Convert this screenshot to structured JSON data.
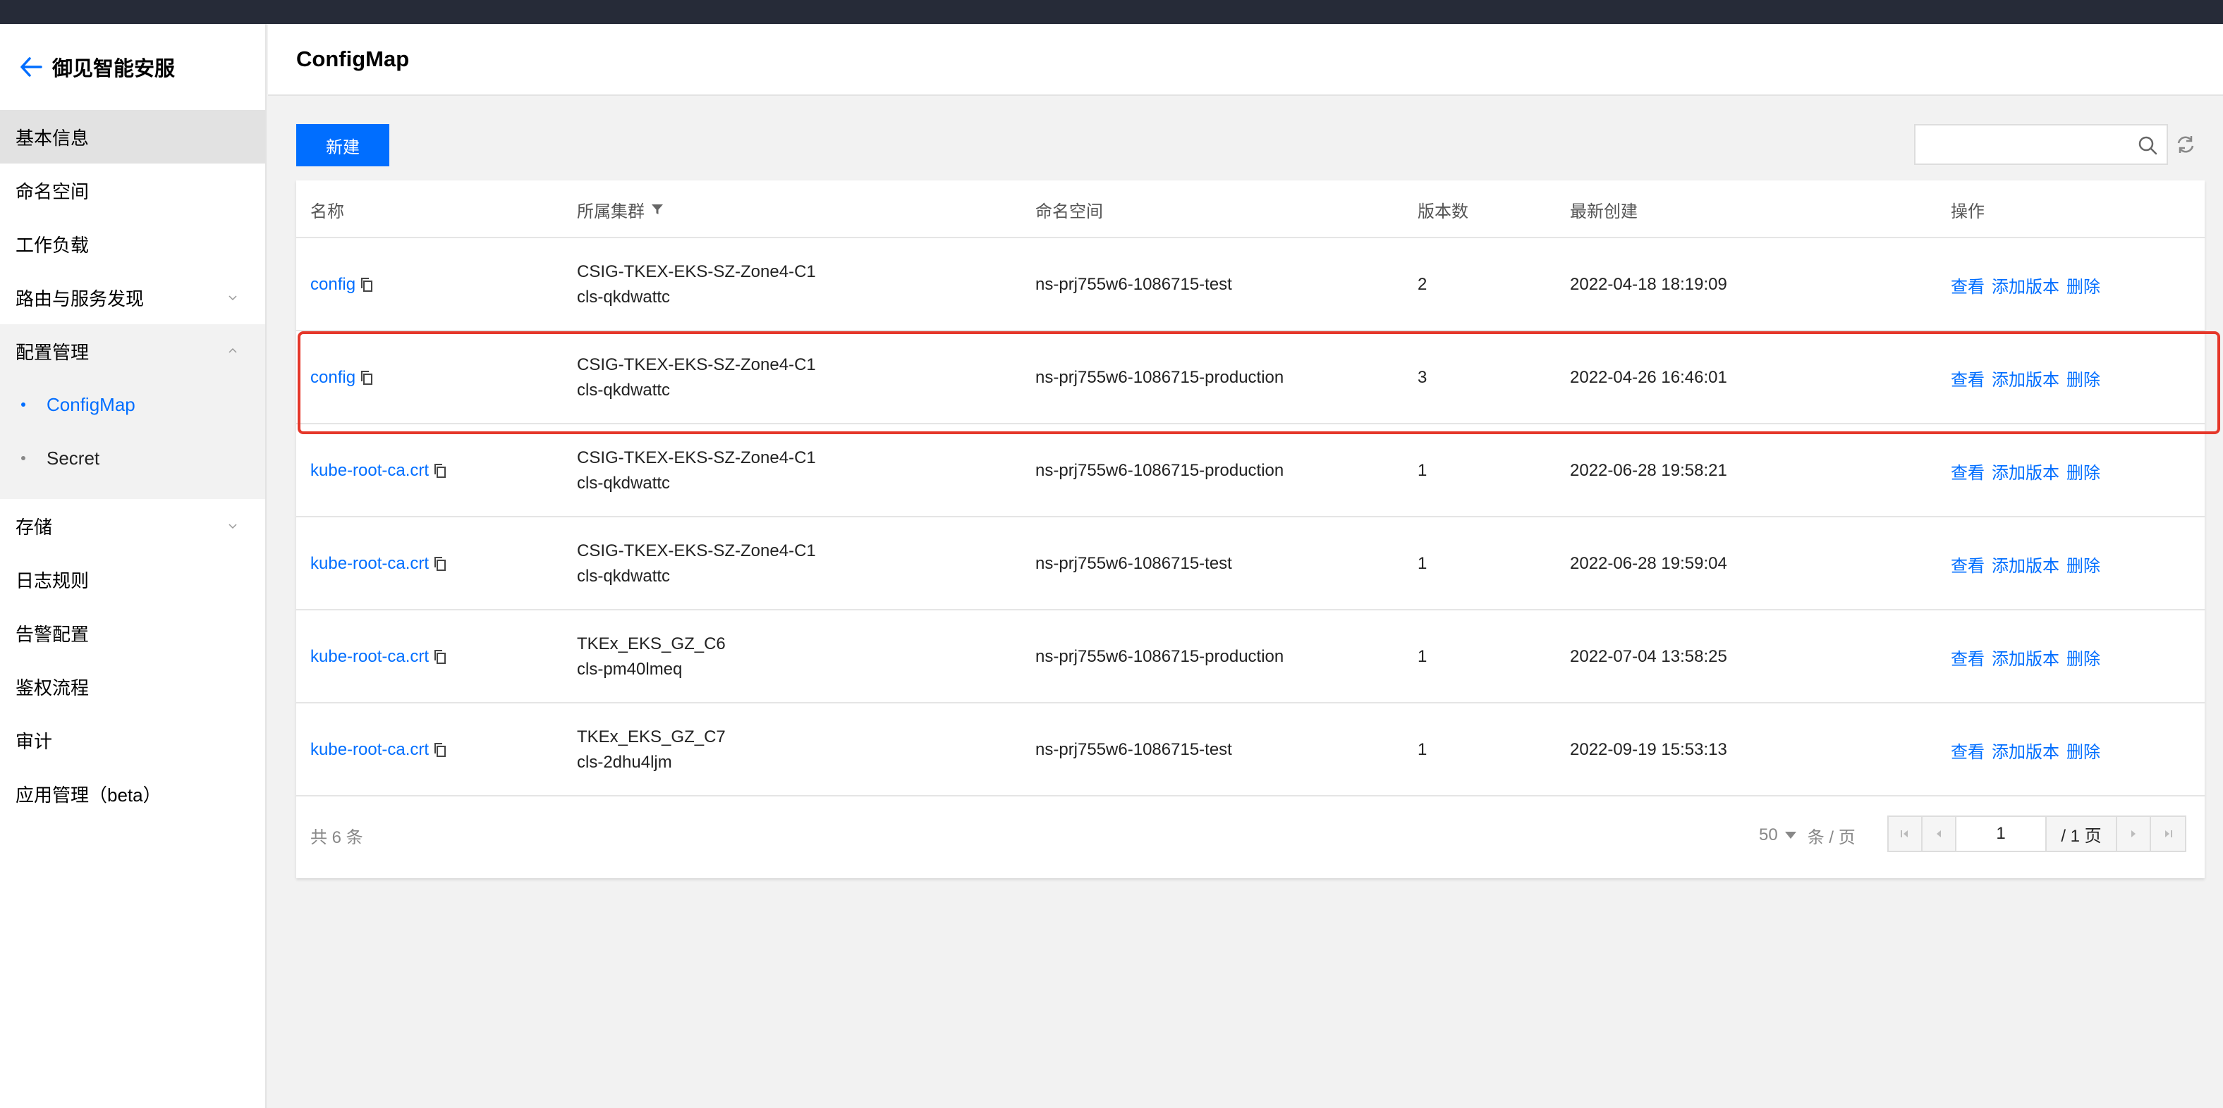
{
  "sidebar": {
    "title": "御见智能安服",
    "items": [
      {
        "label": "基本信息"
      },
      {
        "label": "命名空间"
      },
      {
        "label": "工作负载"
      },
      {
        "label": "路由与服务发现"
      },
      {
        "label": "配置管理"
      },
      {
        "label": "存储"
      },
      {
        "label": "日志规则"
      },
      {
        "label": "告警配置"
      },
      {
        "label": "鉴权流程"
      },
      {
        "label": "审计"
      },
      {
        "label": "应用管理（beta）"
      }
    ],
    "sub_items": [
      {
        "label": "ConfigMap"
      },
      {
        "label": "Secret"
      }
    ]
  },
  "header": {
    "title": "ConfigMap"
  },
  "toolbar": {
    "new_label": "新建",
    "search_placeholder": ""
  },
  "table": {
    "columns": [
      "名称",
      "所属集群",
      "命名空间",
      "版本数",
      "最新创建",
      "操作"
    ],
    "actions": [
      "查看",
      "添加版本",
      "删除"
    ],
    "rows": [
      {
        "name": "config",
        "cluster": "CSIG-TKEX-EKS-SZ-Zone4-C1",
        "cluster_id": "cls-qkdwattc",
        "namespace": "ns-prj755w6-1086715-test",
        "versions": "2",
        "created": "2022-04-18 18:19:09"
      },
      {
        "name": "config",
        "cluster": "CSIG-TKEX-EKS-SZ-Zone4-C1",
        "cluster_id": "cls-qkdwattc",
        "namespace": "ns-prj755w6-1086715-production",
        "versions": "3",
        "created": "2022-04-26 16:46:01"
      },
      {
        "name": "kube-root-ca.crt",
        "cluster": "CSIG-TKEX-EKS-SZ-Zone4-C1",
        "cluster_id": "cls-qkdwattc",
        "namespace": "ns-prj755w6-1086715-production",
        "versions": "1",
        "created": "2022-06-28 19:58:21"
      },
      {
        "name": "kube-root-ca.crt",
        "cluster": "CSIG-TKEX-EKS-SZ-Zone4-C1",
        "cluster_id": "cls-qkdwattc",
        "namespace": "ns-prj755w6-1086715-test",
        "versions": "1",
        "created": "2022-06-28 19:59:04"
      },
      {
        "name": "kube-root-ca.crt",
        "cluster": "TKEx_EKS_GZ_C6",
        "cluster_id": "cls-pm40lmeq",
        "namespace": "ns-prj755w6-1086715-production",
        "versions": "1",
        "created": "2022-07-04 13:58:25"
      },
      {
        "name": "kube-root-ca.crt",
        "cluster": "TKEx_EKS_GZ_C7",
        "cluster_id": "cls-2dhu4ljm",
        "namespace": "ns-prj755w6-1086715-test",
        "versions": "1",
        "created": "2022-09-19 15:53:13"
      }
    ]
  },
  "footer": {
    "total": "共 6 条",
    "page_size": "50",
    "page_size_unit": "条 / 页",
    "current_page": "1",
    "total_pages": "/ 1 页"
  },
  "colors": {
    "accent": "#006eff",
    "topbar": "#262b38",
    "highlight": "#e5372a"
  }
}
